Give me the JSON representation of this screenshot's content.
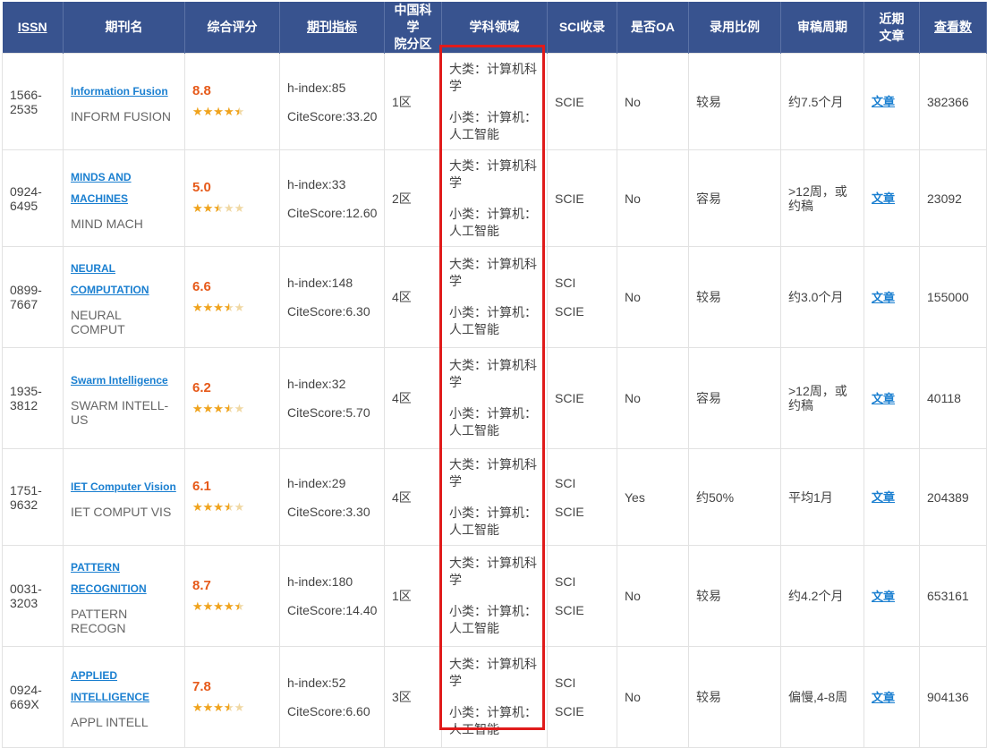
{
  "headers": {
    "issn": "ISSN",
    "journal": "期刊名",
    "score": "综合评分",
    "metrics": "期刊指标",
    "cas_line1": "中国科学",
    "cas_line2": "院分区",
    "subject": "学科领域",
    "sci": "SCI收录",
    "oa": "是否OA",
    "acceptance": "录用比例",
    "review": "审稿周期",
    "recent_line1": "近期",
    "recent_line2": "文章",
    "views": "查看数"
  },
  "rows": [
    {
      "issn_a": "1566-",
      "issn_b": "2535",
      "name_lines": [
        "Information Fusion"
      ],
      "abbr": "INFORM FUSION",
      "score": "8.8",
      "stars": 0.9,
      "hindex": "h-index:85",
      "citescore": "CiteScore:33.20",
      "cas": "1区",
      "subject_major": "大类：计算机科学",
      "subject_minor": "小类：计算机：人工智能",
      "sci": [
        "SCIE"
      ],
      "oa": "No",
      "acceptance": "较易",
      "review": "约7.5个月",
      "article": "文章",
      "views": "382366"
    },
    {
      "issn_a": "0924-",
      "issn_b": "6495",
      "name_lines": [
        "MINDS AND",
        "MACHINES"
      ],
      "abbr": "MIND MACH",
      "score": "5.0",
      "stars": 0.5,
      "hindex": "h-index:33",
      "citescore": "CiteScore:12.60",
      "cas": "2区",
      "subject_major": "大类：计算机科学",
      "subject_minor": "小类：计算机：人工智能",
      "sci": [
        "SCIE"
      ],
      "oa": "No",
      "acceptance": "容易",
      "review": ">12周，或约稿",
      "article": "文章",
      "views": "23092"
    },
    {
      "issn_a": "0899-",
      "issn_b": "7667",
      "name_lines": [
        "NEURAL",
        "COMPUTATION"
      ],
      "abbr": "NEURAL COMPUT",
      "score": "6.6",
      "stars": 0.7,
      "hindex": "h-index:148",
      "citescore": "CiteScore:6.30",
      "cas": "4区",
      "subject_major": "大类：计算机科学",
      "subject_minor": "小类：计算机：人工智能",
      "sci": [
        "SCI",
        "SCIE"
      ],
      "oa": "No",
      "acceptance": "较易",
      "review": "约3.0个月",
      "article": "文章",
      "views": "155000"
    },
    {
      "issn_a": "1935-",
      "issn_b": "3812",
      "name_lines": [
        "Swarm Intelligence"
      ],
      "abbr": "SWARM INTELL-US",
      "score": "6.2",
      "stars": 0.7,
      "hindex": "h-index:32",
      "citescore": "CiteScore:5.70",
      "cas": "4区",
      "subject_major": "大类：计算机科学",
      "subject_minor": "小类：计算机：人工智能",
      "sci": [
        "SCIE"
      ],
      "oa": "No",
      "acceptance": "容易",
      "review": ">12周，或约稿",
      "article": "文章",
      "views": "40118"
    },
    {
      "issn_a": "1751-",
      "issn_b": "9632",
      "name_lines": [
        "IET Computer Vision"
      ],
      "abbr": "IET COMPUT VIS",
      "score": "6.1",
      "stars": 0.7,
      "hindex": "h-index:29",
      "citescore": "CiteScore:3.30",
      "cas": "4区",
      "subject_major": "大类：计算机科学",
      "subject_minor": "小类：计算机：人工智能",
      "sci": [
        "SCI",
        "SCIE"
      ],
      "oa": "Yes",
      "acceptance": "约50%",
      "review": "平均1月",
      "article": "文章",
      "views": "204389"
    },
    {
      "issn_a": "0031-",
      "issn_b": "3203",
      "name_lines": [
        "PATTERN",
        "RECOGNITION"
      ],
      "abbr": "PATTERN RECOGN",
      "score": "8.7",
      "stars": 0.9,
      "hindex": "h-index:180",
      "citescore": "CiteScore:14.40",
      "cas": "1区",
      "subject_major": "大类：计算机科学",
      "subject_minor": "小类：计算机：人工智能",
      "sci": [
        "SCI",
        "SCIE"
      ],
      "oa": "No",
      "acceptance": "较易",
      "review": "约4.2个月",
      "article": "文章",
      "views": "653161"
    },
    {
      "issn_a": "0924-",
      "issn_b": "669X",
      "name_lines": [
        "APPLIED",
        "INTELLIGENCE"
      ],
      "abbr": "APPL INTELL",
      "score": "7.8",
      "stars": 0.7,
      "hindex": "h-index:52",
      "citescore": "CiteScore:6.60",
      "cas": "3区",
      "subject_major": "大类：计算机科学",
      "subject_minor": "小类：计算机：人工智能",
      "sci": [
        "SCI",
        "SCIE"
      ],
      "oa": "No",
      "acceptance": "较易",
      "review": "偏慢,4-8周",
      "article": "文章",
      "views": "904136"
    }
  ],
  "colors": {
    "header_bg": "#38538f",
    "link": "#1a7fd0",
    "score": "#e65a1a",
    "star": "#f0a31d",
    "highlight": "#e01b1b"
  }
}
